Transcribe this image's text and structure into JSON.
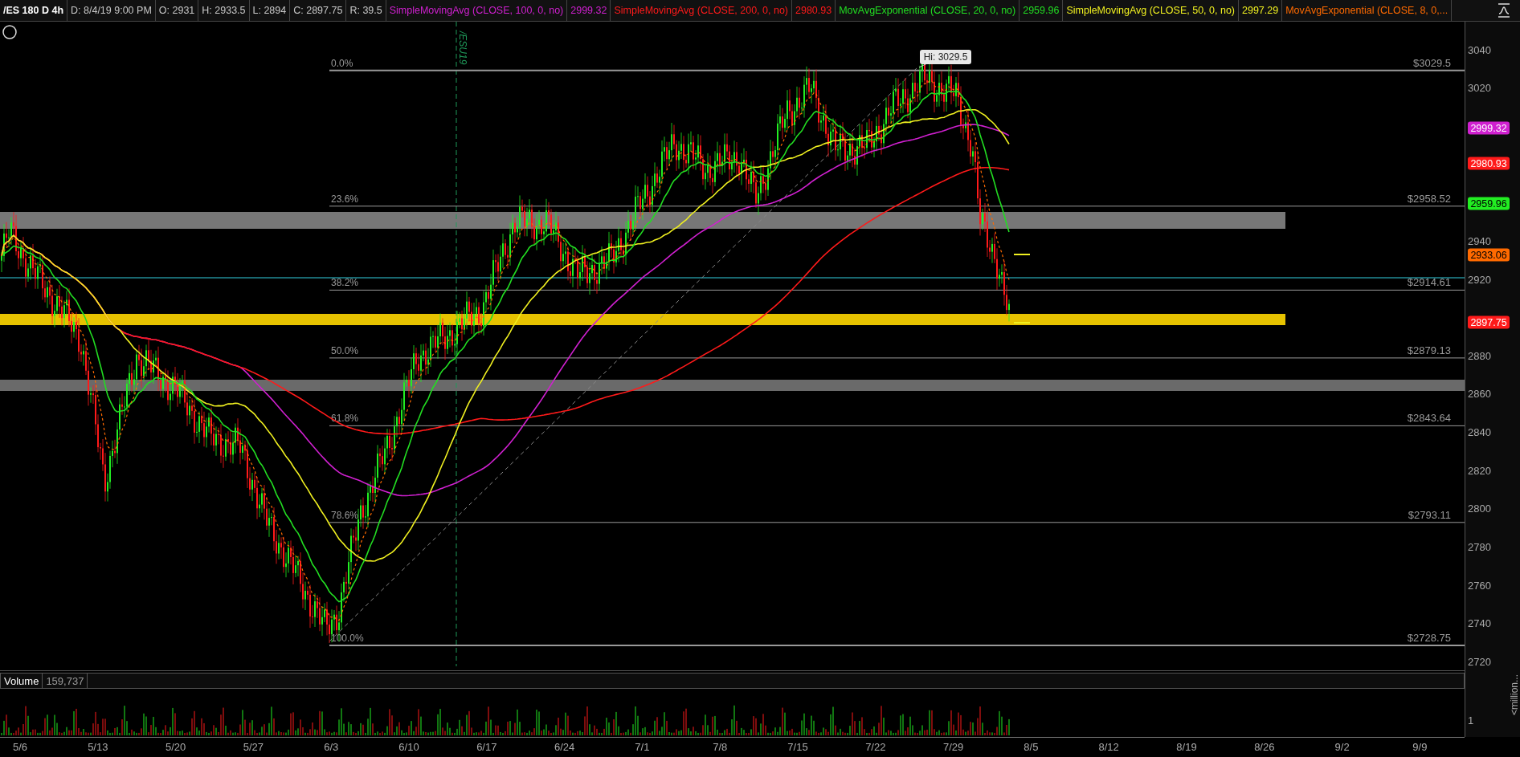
{
  "header": {
    "symbol": "/ES 180 D 4h",
    "fields": [
      "D: 8/4/19 9:00 PM",
      "O: 2931",
      "H: 2933.5",
      "L: 2894",
      "C: 2897.75",
      "R: 39.5"
    ],
    "studies": [
      {
        "label": "SimpleMovingAvg (CLOSE, 100, 0, no)",
        "value": "2999.32",
        "color": "#d020d0"
      },
      {
        "label": "SimpleMovingAvg (CLOSE, 200, 0, no)",
        "value": "2980.93",
        "color": "#ff1a1a"
      },
      {
        "label": "MovAvgExponential (CLOSE, 20, 0, no)",
        "value": "2959.96",
        "color": "#22dd22"
      },
      {
        "label": "SimpleMovingAvg (CLOSE, 50, 0, no)",
        "value": "2997.29",
        "color": "#f0f020"
      },
      {
        "label": "MovAvgExponential (CLOSE, 8, 0,...",
        "color": "#ff6a00"
      }
    ]
  },
  "price_chart": {
    "contract_marker": "/ESU19",
    "high_callout": "Hi: 3029.5",
    "fib_levels": [
      {
        "percent": "0.0%",
        "price": "$3029.5"
      },
      {
        "percent": "23.6%",
        "price": "$2958.52"
      },
      {
        "percent": "38.2%",
        "price": "$2914.61"
      },
      {
        "percent": "50.0%",
        "price": "$2879.13"
      },
      {
        "percent": "61.8%",
        "price": "$2843.64"
      },
      {
        "percent": "78.6%",
        "price": "$2793.11"
      },
      {
        "percent": "100.0%",
        "price": "$2728.75"
      }
    ],
    "price_axis": [
      "3040",
      "3020",
      "2940",
      "2920",
      "2880",
      "2860",
      "2840",
      "2820",
      "2800",
      "2780",
      "2760",
      "2740",
      "2720"
    ],
    "badges": [
      {
        "value": "2999.32",
        "color": "#d020d0"
      },
      {
        "value": "2980.93",
        "color": "#ff1a1a"
      },
      {
        "value": "2959.96",
        "color": "#22ee22"
      },
      {
        "value": "2933.06",
        "color": "#ff6a00"
      },
      {
        "value": "2897.75",
        "color": "#ff1a1a"
      }
    ]
  },
  "volume": {
    "title": "Volume",
    "value": "159,737",
    "axis": [
      "1"
    ],
    "unit": "<million..."
  },
  "date_axis": [
    "5/6",
    "5/13",
    "5/20",
    "5/27",
    "6/3",
    "6/10",
    "6/17",
    "6/24",
    "7/1",
    "7/8",
    "7/15",
    "7/22",
    "7/29",
    "8/5",
    "8/12",
    "8/19",
    "8/26",
    "9/2",
    "9/9"
  ]
}
